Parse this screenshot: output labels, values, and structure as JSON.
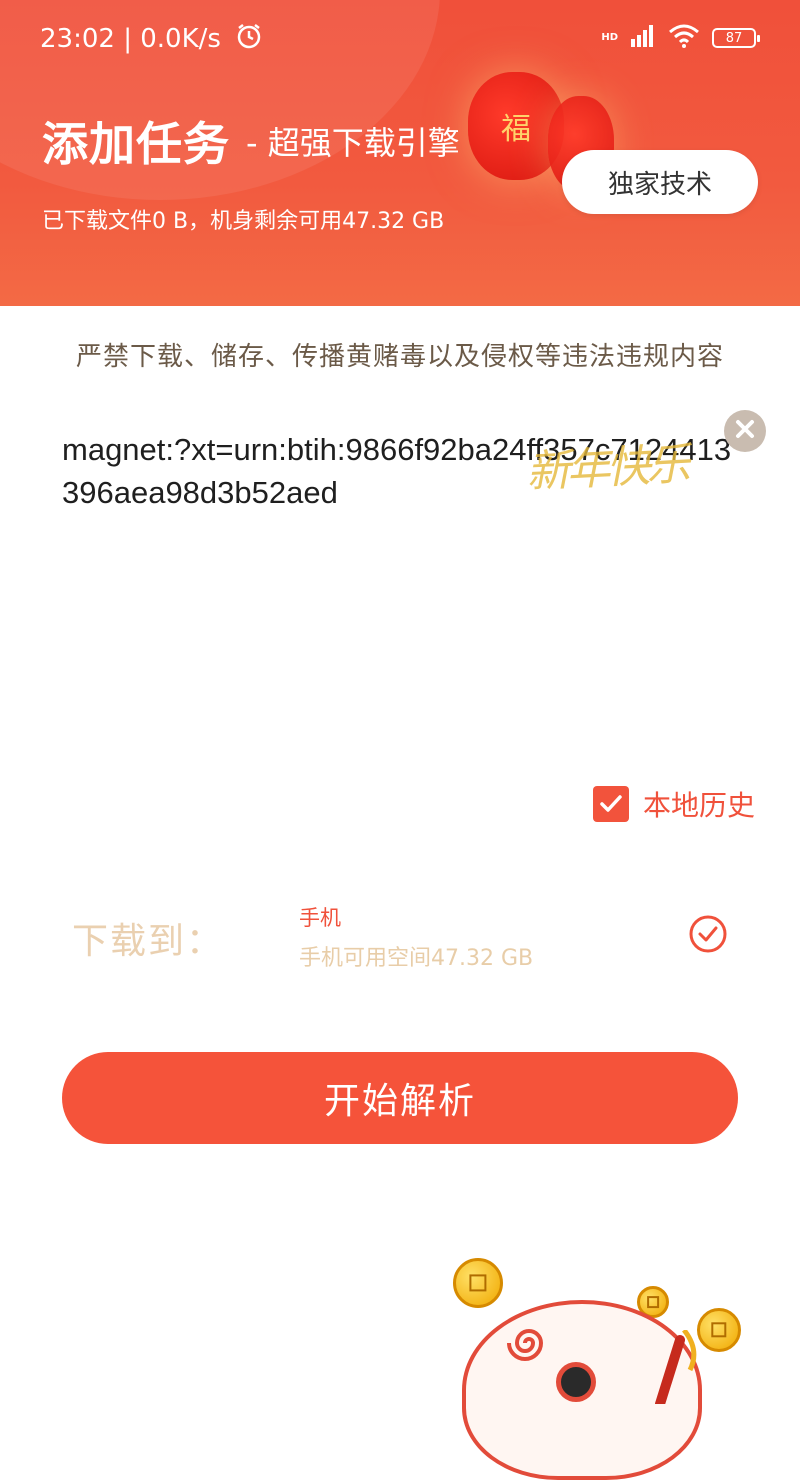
{
  "status_bar": {
    "time_speed": "23:02 | 0.0K/s",
    "network_badge": "HD",
    "battery": "87",
    "icons": [
      "alarm-icon",
      "signal-icon",
      "wifi-icon",
      "battery-icon"
    ]
  },
  "header": {
    "title": "添加任务",
    "subtitle": "- 超强下载引擎",
    "storage_info": "已下载文件0 B，机身剩余可用47.32 GB",
    "tech_button": "独家技术",
    "lantern_char": "福"
  },
  "notice": "严禁下载、储存、传播黄赌毒以及侵权等违法违规内容",
  "link_input": {
    "value": "magnet:?xt=urn:btih:9866f92ba24ff357c7124413396aea98d3b52aed"
  },
  "decoration_text": "新年快乐",
  "history": {
    "label": "本地历史",
    "checked": true
  },
  "download_target": {
    "label": "下载到：",
    "device": "手机",
    "space": "手机可用空间47.32 GB",
    "selected": true
  },
  "start_button": "开始解析",
  "colors": {
    "accent": "#f2533c",
    "header_bg": "#f0503a",
    "muted_label": "#ead0b0"
  }
}
